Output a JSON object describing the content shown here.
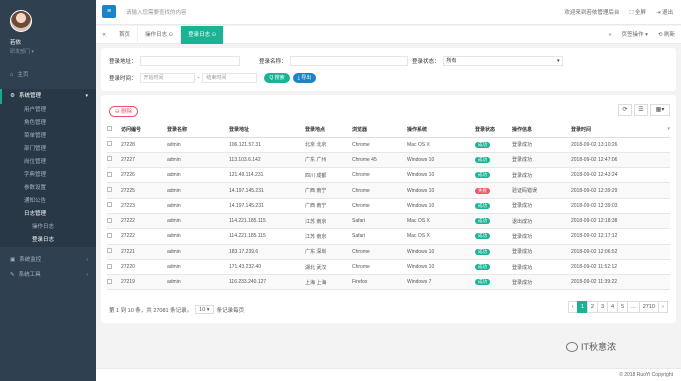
{
  "sidebar": {
    "user_name": "若依",
    "user_dept": "研发部门 ▾",
    "items": [
      {
        "label": "主页",
        "icon": "home-icon"
      },
      {
        "label": "系统管理",
        "icon": "gear-icon"
      },
      {
        "label": "系统监控",
        "icon": "monitor-icon"
      },
      {
        "label": "系统工具",
        "icon": "wrench-icon"
      }
    ],
    "sub_items": [
      "用户管理",
      "角色管理",
      "菜单管理",
      "部门管理",
      "岗位管理",
      "字典管理",
      "参数设置",
      "通知公告",
      "日志管理"
    ],
    "log_items": [
      "操作日志",
      "登录日志"
    ]
  },
  "topbar": {
    "search_placeholder": "请输入您需要查找的内容",
    "welcome": "欢迎来到若依管理后台",
    "fullscreen": "全屏",
    "logout": "退出"
  },
  "tabs": {
    "items": [
      "首页",
      "操作日志 ⊙",
      "登录日志 ⊙"
    ],
    "page_ops": "页签操作 ▾",
    "refresh": "刷新"
  },
  "search": {
    "addr_label": "登录地址：",
    "name_label": "登录名称：",
    "status_label": "登录状态：",
    "status_value": "所有",
    "time_label": "登录时间：",
    "start_placeholder": "开始时间",
    "sep": "-",
    "end_placeholder": "结束时间",
    "search_btn": "Q 搜索",
    "export_btn": "⤓ 导出"
  },
  "table": {
    "delete_btn": "⊖ 删除",
    "columns": [
      "访问编号",
      "登录名称",
      "登录地址",
      "登录地点",
      "浏览器",
      "操作系统",
      "登录状态",
      "操作信息",
      "登录时间"
    ],
    "rows": [
      [
        "27228",
        "admin",
        "106.121.57.31",
        "北京 北京",
        "Chrome",
        "Mac OS X",
        "成功",
        "登录成功",
        "2018-09-02 13:10:26"
      ],
      [
        "27227",
        "admin",
        "113.103.6.142",
        "广东 广州",
        "Chrome 45",
        "Windows 10",
        "成功",
        "登录成功",
        "2018-09-02 12:47:06"
      ],
      [
        "27226",
        "admin",
        "121.49.114.231",
        "四川 成都",
        "Chrome",
        "Windows 10",
        "成功",
        "登录成功",
        "2018-09-02 12:43:24"
      ],
      [
        "27225",
        "admin",
        "14.197.145.231",
        "广西 南宁",
        "Chrome",
        "Windows 10",
        "失败",
        "验证码错误",
        "2018-09-02 12:39:29"
      ],
      [
        "27223",
        "admin",
        "14.197.145.231",
        "广西 南宁",
        "Chrome",
        "Windows 10",
        "成功",
        "登录成功",
        "2018-09-02 12:39:03"
      ],
      [
        "27222",
        "admin",
        "114.221.185.115",
        "江苏 南京",
        "Safari",
        "Mac OS X",
        "成功",
        "退出成功",
        "2018-09-02 12:18:38"
      ],
      [
        "27222",
        "admin",
        "114.221.185.115",
        "江苏 南京",
        "Safari",
        "Mac OS X",
        "成功",
        "登录成功",
        "2018-09-02 12:17:12"
      ],
      [
        "27221",
        "admin",
        "183.17.239.6",
        "广东 深圳",
        "Chrome",
        "Windows 10",
        "成功",
        "登录成功",
        "2018-09-02 12:06:52"
      ],
      [
        "27220",
        "admin",
        "171.43.232.40",
        "湖北 武汉",
        "Chrome",
        "Windows 10",
        "成功",
        "登录成功",
        "2018-09-02 11:52:12"
      ],
      [
        "27219",
        "admin",
        "116.233.240.127",
        "上海 上海",
        "Firefox",
        "Windows 7",
        "成功",
        "登录成功",
        "2018-09-02 11:39:22"
      ]
    ],
    "pager_text": "第 1 到 10 条，共 27081 条记录。",
    "page_size": "10 ▾",
    "pager_suffix": "条记录每页",
    "pages": [
      "‹",
      "1",
      "2",
      "3",
      "4",
      "5",
      "...",
      "2710",
      "›"
    ],
    "active_page": "1"
  },
  "watermark": "IT秋意浓",
  "footer": "© 2018 RuoYi Copyright"
}
